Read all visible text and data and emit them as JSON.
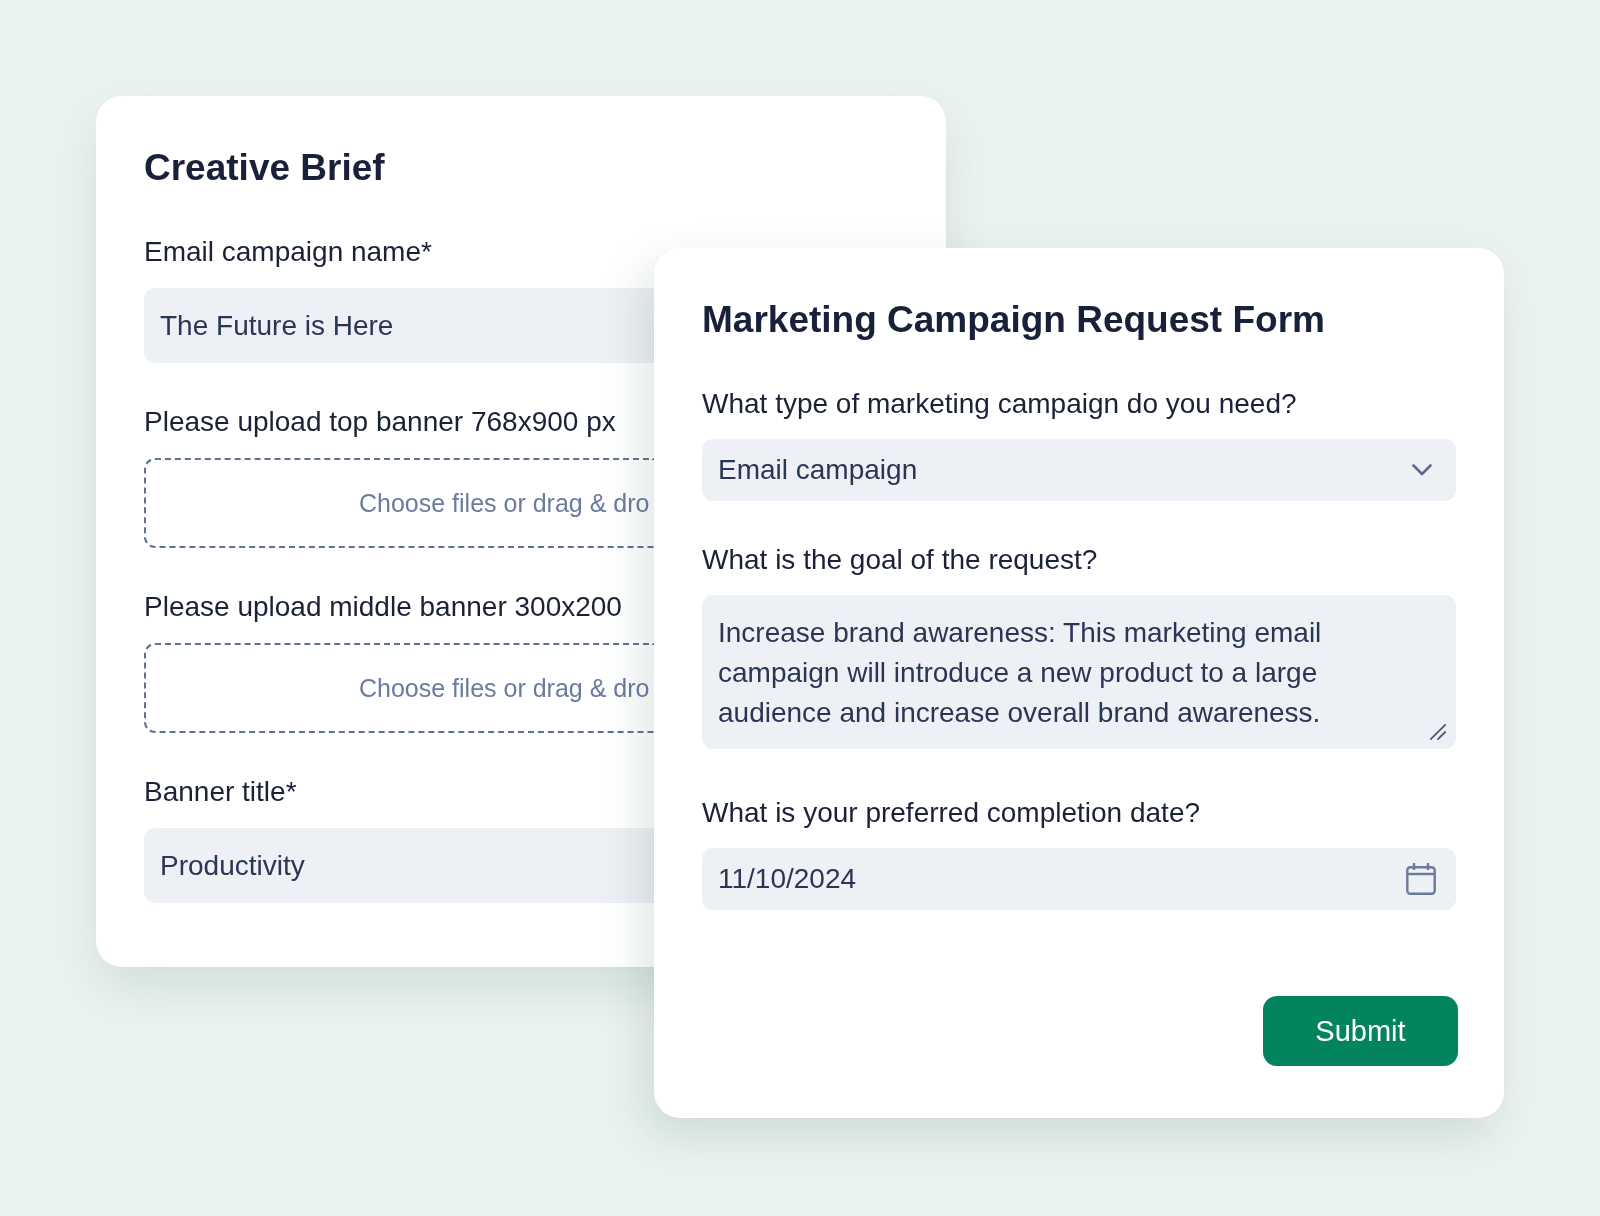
{
  "forms": [
    {
      "title": "Creative Brief",
      "fields": [
        {
          "kind": "text",
          "label": "Email campaign name*",
          "value": "The Future is Here"
        },
        {
          "kind": "upload",
          "label": "Please upload top banner 768x900 px",
          "prompt": "Choose files or drag & dro"
        },
        {
          "kind": "upload",
          "label": "Please upload middle banner 300x200",
          "prompt": "Choose files or drag & dro"
        },
        {
          "kind": "text",
          "label": "Banner title*",
          "value": "Productivity"
        }
      ]
    },
    {
      "title": "Marketing Campaign Request Form",
      "fields": [
        {
          "kind": "select",
          "label": "What type of marketing campaign do you need?",
          "value": "Email campaign"
        },
        {
          "kind": "textarea",
          "label": "What is the goal of the request?",
          "value": "Increase brand awareness: This marketing email campaign will introduce a new product to a large audience and increase overall brand awareness."
        },
        {
          "kind": "date",
          "label": "What is your preferred completion date?",
          "value": "11/10/2024"
        }
      ],
      "submit": "Submit"
    }
  ]
}
